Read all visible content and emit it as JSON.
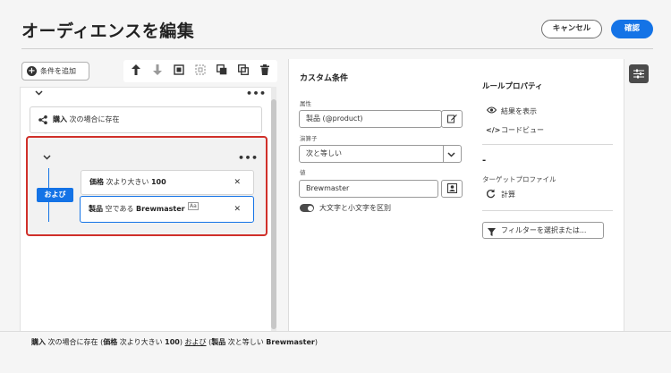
{
  "header": {
    "title": "オーディエンスを編集",
    "cancel_label": "キャンセル",
    "confirm_label": "確認"
  },
  "toolbar": {
    "add_condition_label": "条件を追加"
  },
  "tree": {
    "purchase_condition": {
      "field": "購入",
      "text": "次の場合に存在"
    },
    "group": {
      "operator": "および",
      "conditions": [
        {
          "field": "価格",
          "op": "次より大きい",
          "value": "100"
        },
        {
          "field": "製品",
          "op": "空である",
          "value": "Brewmaster",
          "case_badge": "Aa"
        }
      ]
    }
  },
  "custom_condition": {
    "title": "カスタム条件",
    "attribute_label": "属性",
    "attribute_value": "製品 (@product)",
    "operator_label": "演算子",
    "operator_value": "次と等しい",
    "value_label": "値",
    "value_value": "Brewmaster",
    "case_toggle_label": "大文字と小文字を区別",
    "case_toggle_on": true
  },
  "rule_properties": {
    "title": "ルールプロパティ",
    "view_results": "結果を表示",
    "code_view": "コードビュー",
    "count_value": "-",
    "target_profile_label": "ターゲットプロファイル",
    "calculate": "計算",
    "filter_button": "フィルターを選択または..."
  },
  "summary": {
    "part1": "購入",
    "part2": " 次の場合に存在 (",
    "part3": "価格",
    "part4": " 次より大きい ",
    "part5": "100",
    "part6": ")",
    "link_and": "および",
    "part7": " (",
    "part8": "製品",
    "part9": " 次と等しい ",
    "part10": "Brewmaster",
    "part11": ")"
  },
  "colors": {
    "accent": "#1473e6",
    "selected_border": "#d0302a",
    "toggle_on": "#4b4b4b"
  }
}
